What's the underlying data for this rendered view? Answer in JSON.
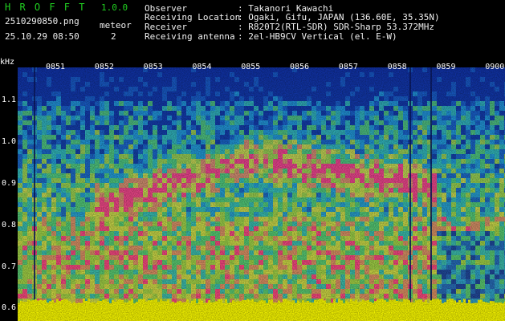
{
  "header": {
    "app_name": "H R O F F T",
    "version": "1.0.0",
    "filename": "2510290850.png",
    "datetime": "25.10.29 08:50",
    "meteor_label": "meteor",
    "meteor_count": "2",
    "fields": [
      {
        "label": "Observer",
        "value": ": Takanori Kawachi"
      },
      {
        "label": "Receiving Location",
        "value": ": Ogaki, Gifu, JAPAN (136.60E, 35.35N)"
      },
      {
        "label": "Receiver",
        "value": ": R820T2(RTL-SDR) SDR-Sharp 53.372MHz"
      },
      {
        "label": "Receiving antenna",
        "value": ": 2el-HB9CV Vertical (el. E-W)"
      }
    ]
  },
  "chart_data": {
    "type": "heatmap",
    "ylabel": "kHz",
    "y_ticks": [
      "1.1",
      "1.0",
      "0.9",
      "0.8",
      "0.7",
      "0.6"
    ],
    "x_ticks": [
      "0851",
      "0852",
      "0853",
      "0854",
      "0855",
      "0856",
      "0857",
      "0858",
      "0859",
      "0900"
    ],
    "ylim": [
      0.57,
      1.18
    ],
    "colors": {
      "low": "#1030a0",
      "mid_low": "#20a0d0",
      "mid": "#40c080",
      "mid_high": "#d0d040",
      "high": "#ff2080",
      "baseline": "#f0f000"
    }
  }
}
